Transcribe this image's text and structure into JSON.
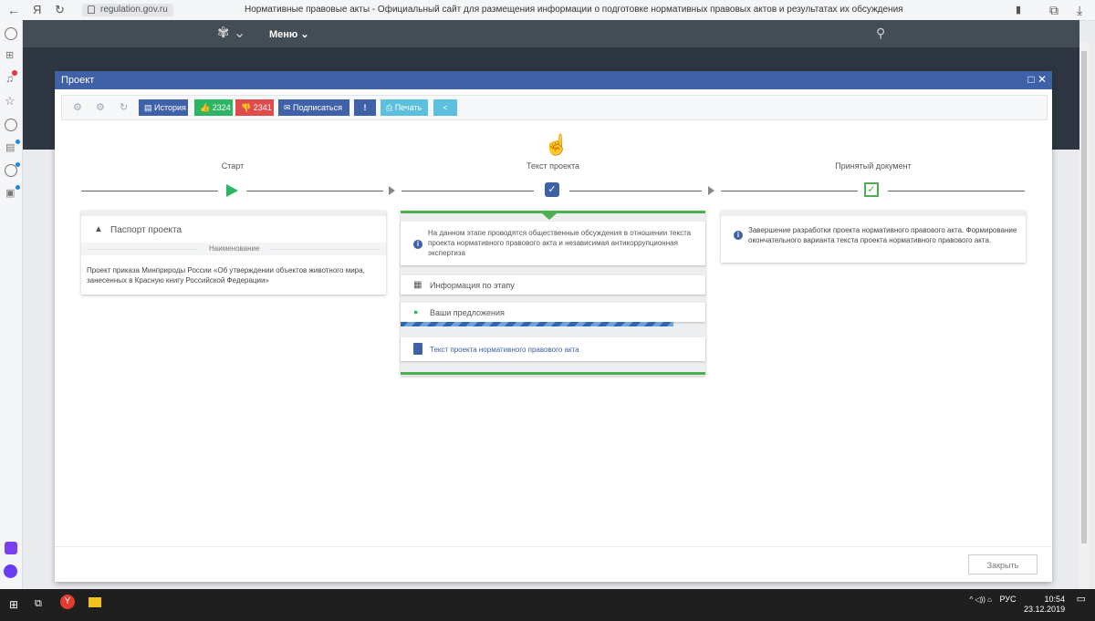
{
  "browser": {
    "url": "regulation.gov.ru",
    "title": "Нормативные правовые акты - Официальный сайт для размещения информации о подготовке нормативных правовых актов и результатах их обсуждения",
    "yandex_letter": "Я"
  },
  "site_header": {
    "menu_label": "Меню"
  },
  "modal": {
    "title": "Проект",
    "toolbar": {
      "history_label": "История",
      "likes": "2324",
      "dislikes": "2341",
      "subscribe_label": "Подписаться",
      "print_label": "Печать"
    },
    "stages": [
      {
        "label": "Старт"
      },
      {
        "label": "Текст проекта"
      },
      {
        "label": "Принятый документ"
      }
    ],
    "passport": {
      "title": "Паспорт проекта",
      "name_header": "Наименование",
      "name_value": "Проект приказа Минприроды России «Об утверждении объектов животного мира, занесенных в Красную книгу Российской Федерации»"
    },
    "text_stage": {
      "info": "На данном этапе проводятся общественные обсуждения в отношении текста проекта нормативного правового акта и независимая антикоррупционная экспертиза",
      "stage_info_label": "Информация по этапу",
      "proposals_label": "Ваши предложения",
      "doc_link": "Текст проекта нормативного правового акта"
    },
    "final_stage": {
      "info": "Завершение разработки проекта нормативного правового акта. Формирование окончательного варианта текста проекта нормативного правового акта."
    },
    "close_label": "Закрыть"
  },
  "taskbar": {
    "lang": "РУС",
    "time": "10:54",
    "date": "23.12.2019"
  },
  "colors": {
    "primary": "#3f61a8",
    "green": "#2db563",
    "red": "#e04b4b",
    "light_blue": "#5bc0de"
  }
}
